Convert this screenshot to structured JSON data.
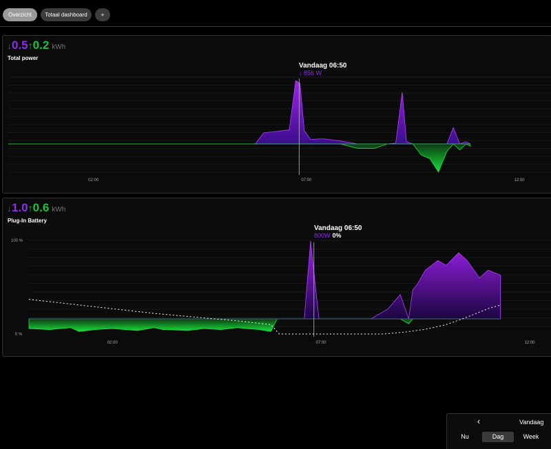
{
  "tabs": [
    {
      "label": "Overzicht",
      "active": true
    },
    {
      "label": "Totaal dashboard",
      "active": false
    },
    {
      "label": "+",
      "active": false
    }
  ],
  "total_power": {
    "import_value": "0.5",
    "export_value": "0.2",
    "unit": "kWh",
    "title": "Total power",
    "tooltip": {
      "time": "Vandaag 06:50",
      "value": "856 W"
    },
    "colors": {
      "import": "#8f2bf0",
      "export": "#19c23a"
    }
  },
  "plug_in_battery": {
    "import_value": "1.0",
    "export_value": "0.6",
    "unit": "kWh",
    "title": "Plug-In Battery",
    "tooltip": {
      "time": "Vandaag 06:50",
      "power": "800W",
      "soc": "0%"
    },
    "y_max_label": "100 %",
    "y_min_label": "0 %"
  },
  "range_panel": {
    "today": "Vandaag",
    "options": [
      {
        "label": "Nu",
        "selected": false
      },
      {
        "label": "Dag",
        "selected": true
      },
      {
        "label": "Week",
        "selected": false
      }
    ]
  },
  "chart_data": [
    {
      "type": "area",
      "title": "Total power",
      "x_ticks": [
        "02:00",
        "07:00",
        "12:00"
      ],
      "x_range_hours": [
        0,
        12
      ],
      "y_unit": "W",
      "series": [
        {
          "name": "",
          "x_hours": [
            0,
            1,
            2,
            3,
            4,
            5,
            5.8,
            6.0,
            6.3,
            6.6,
            6.75,
            6.85,
            6.95,
            7.1,
            7.4,
            7.8,
            8.2,
            8.6,
            8.9,
            9.1,
            9.25,
            9.35,
            9.5,
            9.7,
            9.9,
            10.1,
            10.3,
            10.45,
            10.6,
            10.75,
            10.85
          ],
          "values": [
            0,
            0,
            0,
            0,
            0,
            0,
            0,
            150,
            170,
            190,
            856,
            820,
            180,
            60,
            70,
            40,
            -60,
            -60,
            0,
            10,
            700,
            30,
            0,
            -150,
            -200,
            -380,
            -100,
            220,
            -80,
            30,
            -30
          ]
        }
      ]
    },
    {
      "type": "area",
      "title": "Plug-In Battery",
      "x_ticks": [
        "02:00",
        "07:00",
        "12:00"
      ],
      "x_range_hours": [
        0,
        12
      ],
      "y_ticks": [
        "0 %",
        "100 %"
      ],
      "series": [
        {
          "name": "",
          "x_hours": [
            0,
            0.5,
            1.0,
            1.2,
            1.6,
            2.0,
            2.6,
            3.0,
            3.2,
            3.8,
            4.2,
            4.6,
            5.0,
            5.2,
            5.5,
            5.8,
            5.95,
            6.2,
            6.6,
            6.75,
            6.95,
            7.2,
            7.8,
            8.2,
            8.6,
            8.9,
            9.1,
            9.2,
            9.3,
            9.5,
            9.8,
            10.0,
            10.3,
            10.5,
            10.8,
            11.0,
            11.3
          ],
          "values": [
            -100,
            -110,
            -90,
            -130,
            -110,
            -100,
            -120,
            -90,
            -110,
            -120,
            -100,
            -110,
            -90,
            -100,
            -110,
            -130,
            0,
            0,
            0,
            800,
            0,
            0,
            0,
            0,
            100,
            250,
            -50,
            300,
            350,
            500,
            600,
            550,
            680,
            600,
            420,
            500,
            450
          ]
        },
        {
          "name": "",
          "x_hours": [
            0,
            1,
            2,
            3,
            4,
            5,
            5.8,
            6.0,
            6.5,
            7.0,
            8.0,
            8.5,
            9.0,
            9.5,
            10.0,
            10.5,
            11.0,
            11.3
          ],
          "values": [
            37,
            32,
            27,
            22,
            18,
            14,
            10,
            0,
            0,
            0,
            0,
            0,
            2,
            5,
            10,
            18,
            27,
            31
          ]
        }
      ]
    }
  ]
}
